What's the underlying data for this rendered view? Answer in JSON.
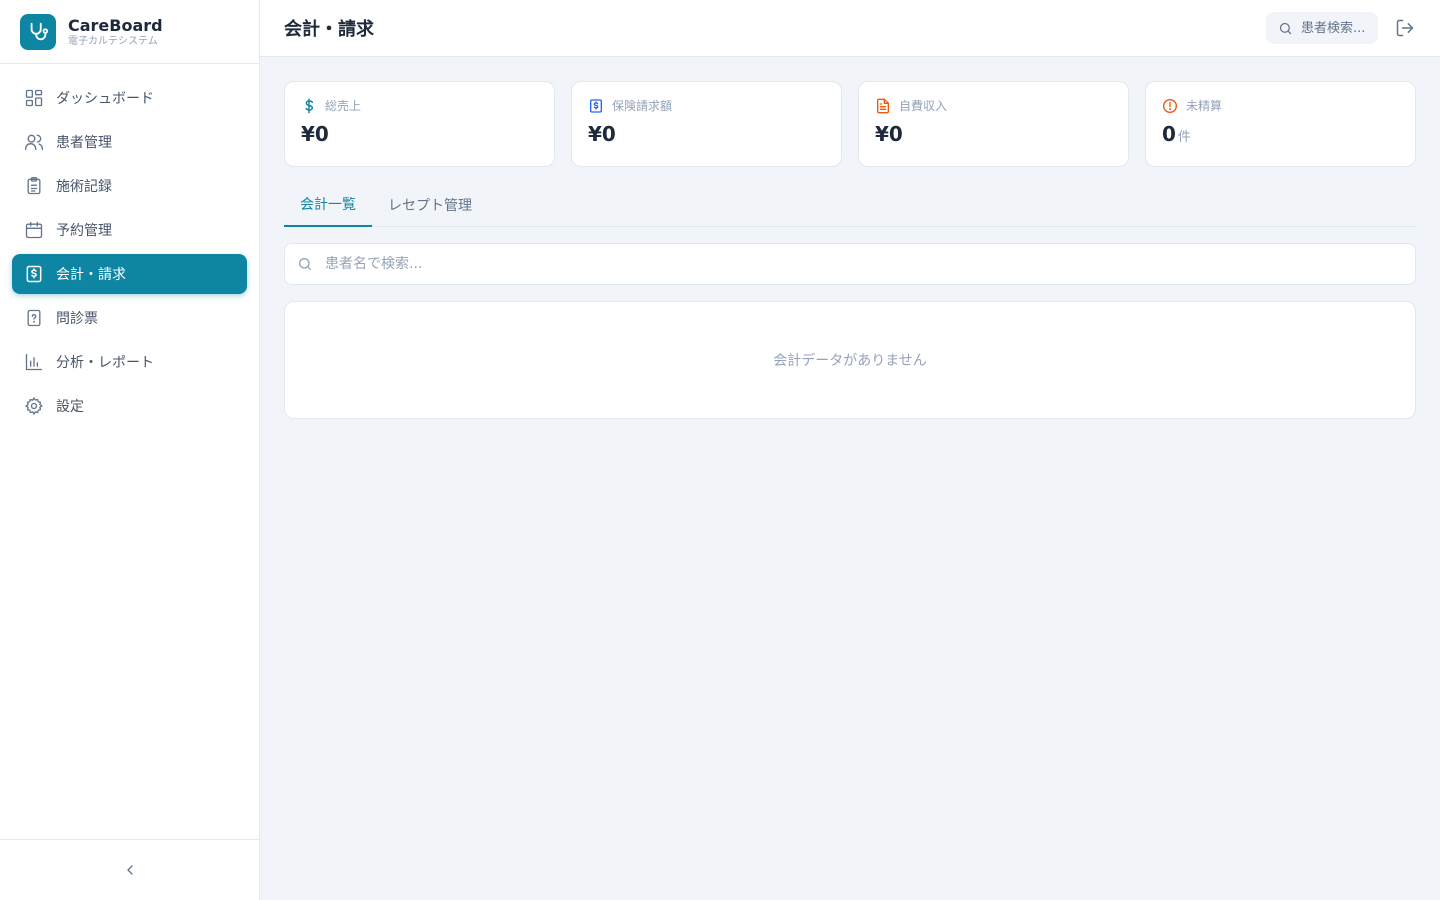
{
  "brand": {
    "name": "CareBoard",
    "subtitle": "電子カルテシステム",
    "accent_color": "#0e86a3"
  },
  "sidebar": {
    "items": [
      {
        "label": "ダッシュボード",
        "icon": "dashboard-icon",
        "active": false
      },
      {
        "label": "患者管理",
        "icon": "users-icon",
        "active": false
      },
      {
        "label": "施術記録",
        "icon": "clipboard-list-icon",
        "active": false
      },
      {
        "label": "予約管理",
        "icon": "calendar-icon",
        "active": false
      },
      {
        "label": "会計・請求",
        "icon": "receipt-dollar-icon",
        "active": true
      },
      {
        "label": "問診票",
        "icon": "question-file-icon",
        "active": false
      },
      {
        "label": "分析・レポート",
        "icon": "bar-chart-icon",
        "active": false
      },
      {
        "label": "設定",
        "icon": "gear-icon",
        "active": false
      }
    ],
    "collapse_icon": "chevron-left-icon"
  },
  "header": {
    "title": "会計・請求",
    "search_placeholder": "患者検索...",
    "logout_icon": "logout-icon"
  },
  "stats": [
    {
      "label": "総売上",
      "value": "¥0",
      "unit": "",
      "icon": "dollar-icon",
      "icon_color": "#0e86a3"
    },
    {
      "label": "保険請求額",
      "value": "¥0",
      "unit": "",
      "icon": "receipt-icon",
      "icon_color": "#2563eb"
    },
    {
      "label": "自費収入",
      "value": "¥0",
      "unit": "",
      "icon": "document-icon",
      "icon_color": "#ea580c"
    },
    {
      "label": "未精算",
      "value": "0",
      "unit": "件",
      "icon": "alert-circle-icon",
      "icon_color": "#ea580c"
    }
  ],
  "tabs": [
    {
      "label": "会計一覧",
      "active": true
    },
    {
      "label": "レセプト管理",
      "active": false
    }
  ],
  "list": {
    "search_placeholder": "患者名で検索...",
    "empty_message": "会計データがありません"
  }
}
